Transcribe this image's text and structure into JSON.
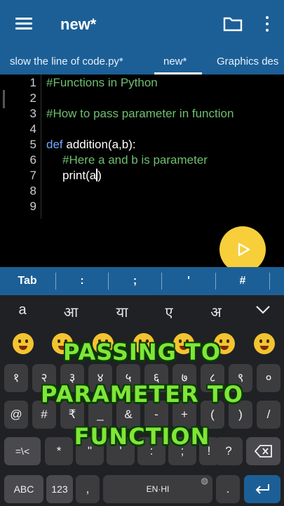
{
  "app": {
    "title": "new*",
    "tabs": [
      "slow the line of code.py*",
      "new*",
      "Graphics des"
    ]
  },
  "editor": {
    "line_numbers": [
      "1",
      "2",
      "3",
      "4",
      "5",
      "6",
      "7",
      "8",
      "9"
    ],
    "lines": {
      "l1": "#Functions in Python",
      "l3": "#How to pass parameter in function",
      "l5_kw": "def",
      "l5_rest": " addition(a,b):",
      "l6": "#Here a and b is parameter",
      "l7_a": "print(",
      "l7_b": "a",
      "l7_c": ")"
    }
  },
  "symbols": [
    "Tab",
    ":",
    ";",
    "'",
    "#"
  ],
  "keyboard": {
    "suggestions": [
      "a",
      "आ",
      "या",
      "ए",
      "अ"
    ],
    "row1": [
      "१",
      "२",
      "३",
      "४",
      "५",
      "६",
      "७",
      "८",
      "९",
      "०"
    ],
    "row2": [
      "@",
      "#",
      "₹",
      "_",
      "&",
      "-",
      "+",
      "(",
      ")",
      "/"
    ],
    "row3": [
      "=\\<",
      "*",
      "\"",
      "'",
      ":",
      ";",
      "!",
      "?"
    ],
    "row4": [
      "ABC",
      "123",
      ",",
      "EN·HI",
      "."
    ],
    "colors": {
      "accent": "#1c5f96",
      "fab": "#f6cf3b",
      "overlay_text": "#7fe639"
    }
  },
  "overlay": {
    "line1": "PASSING TO",
    "line2": "PARAMETER TO",
    "line3": "FUNCTION"
  }
}
